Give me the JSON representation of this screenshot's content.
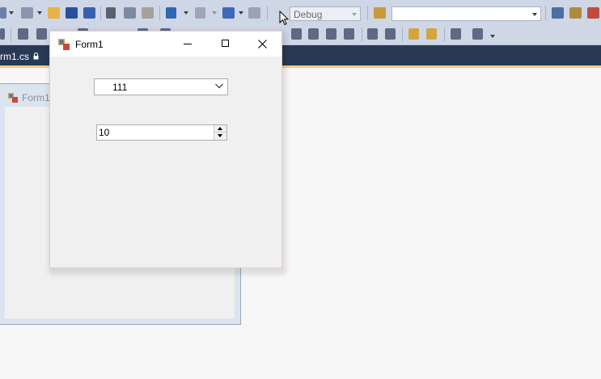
{
  "toolbar": {
    "configuration": "Debug",
    "platform": ""
  },
  "tabs": {
    "document": "rm1.cs"
  },
  "designer_form": {
    "title": "Form1"
  },
  "form": {
    "title": "Form1",
    "combo_value": "111",
    "numeric_value": "10"
  },
  "colors": {
    "toolbar_bg": "#cfd6e5",
    "tab_strip_bg": "#293955",
    "tab_accent": "#f5cc84",
    "designer_bg": "#f7f7f7"
  },
  "icons": [
    "new-project-icon",
    "add-item-icon",
    "open-file-icon",
    "save-icon",
    "save-all-icon",
    "cut-icon",
    "copy-icon",
    "paste-icon",
    "undo-icon",
    "redo-icon",
    "navigate-icon",
    "start-icon",
    "find-in-files-icon",
    "solution-explorer-icon",
    "properties-icon",
    "toolbox-icon",
    "lock-icon",
    "form-icon",
    "minimize-icon",
    "maximize-icon",
    "close-icon",
    "chevron-down-icon",
    "mouse-cursor-icon"
  ]
}
